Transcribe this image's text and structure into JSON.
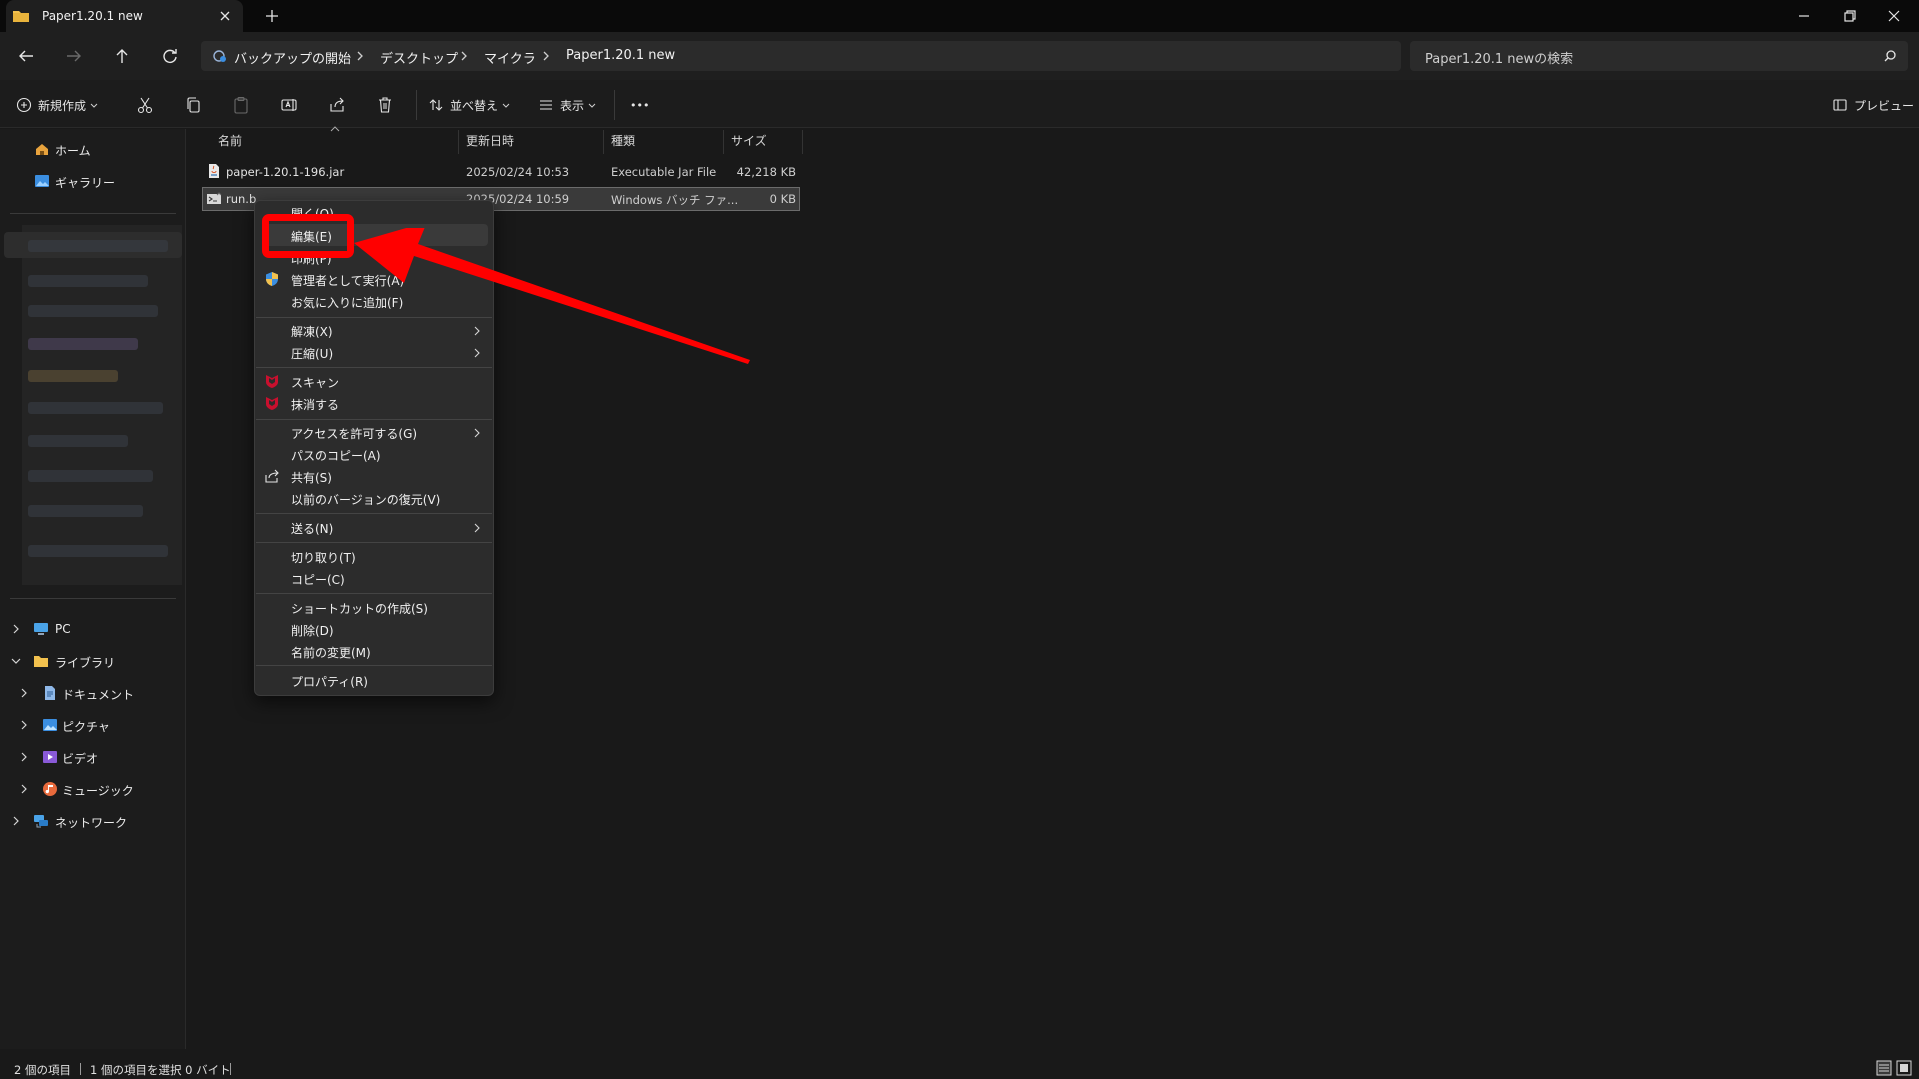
{
  "window": {
    "tab_title": "Paper1.20.1 new",
    "new_tab": "+",
    "controls": [
      "minimize",
      "restore",
      "close"
    ]
  },
  "breadcrumb": [
    "バックアップの開始",
    "デスクトップ",
    "マイクラ",
    "Paper1.20.1 new"
  ],
  "search": {
    "placeholder": "Paper1.20.1 newの検索"
  },
  "toolbar": {
    "new_label": "新規作成",
    "sort_label": "並べ替え",
    "view_label": "表示",
    "more_label": "•••",
    "preview_label": "プレビュー"
  },
  "sidebar": {
    "home": "ホーム",
    "gallery": "ギャラリー",
    "pc": "PC",
    "library": "ライブラリ",
    "documents": "ドキュメント",
    "pictures": "ピクチャ",
    "videos": "ビデオ",
    "music": "ミュージック",
    "network": "ネットワーク"
  },
  "columns": [
    "名前",
    "更新日時",
    "種類",
    "サイズ"
  ],
  "files": [
    {
      "name": "paper-1.20.1-196.jar",
      "modified": "2025/02/24 10:53",
      "type": "Executable Jar File",
      "size": "42,218 KB"
    },
    {
      "name": "run.b",
      "modified": "2025/02/24 10:59",
      "type": "Windows バッチ ファ...",
      "size": "0 KB"
    }
  ],
  "context_menu": {
    "open": "開く(O)",
    "edit": "編集(E)",
    "print": "印刷(P)",
    "run_as_admin": "管理者として実行(A)",
    "add_favorite": "お気に入りに追加(F)",
    "extract": "解凍(X)",
    "compress": "圧縮(U)",
    "scan": "スキャン",
    "shred": "抹消する",
    "give_access": "アクセスを許可する(G)",
    "copy_path": "パスのコピー(A)",
    "share": "共有(S)",
    "restore_versions": "以前のバージョンの復元(V)",
    "send_to": "送る(N)",
    "cut": "切り取り(T)",
    "copy": "コピー(C)",
    "create_shortcut": "ショートカットの作成(S)",
    "delete": "削除(D)",
    "rename": "名前の変更(M)",
    "properties": "プロパティ(R)"
  },
  "status": {
    "item_count": "2 個の項目",
    "selection": "1 個の項目を選択  0 バイト"
  },
  "colors": {
    "background": "#191919",
    "annotation": "#ff0000",
    "folder": "#f2c14e",
    "mcafee": "#c8102e"
  }
}
